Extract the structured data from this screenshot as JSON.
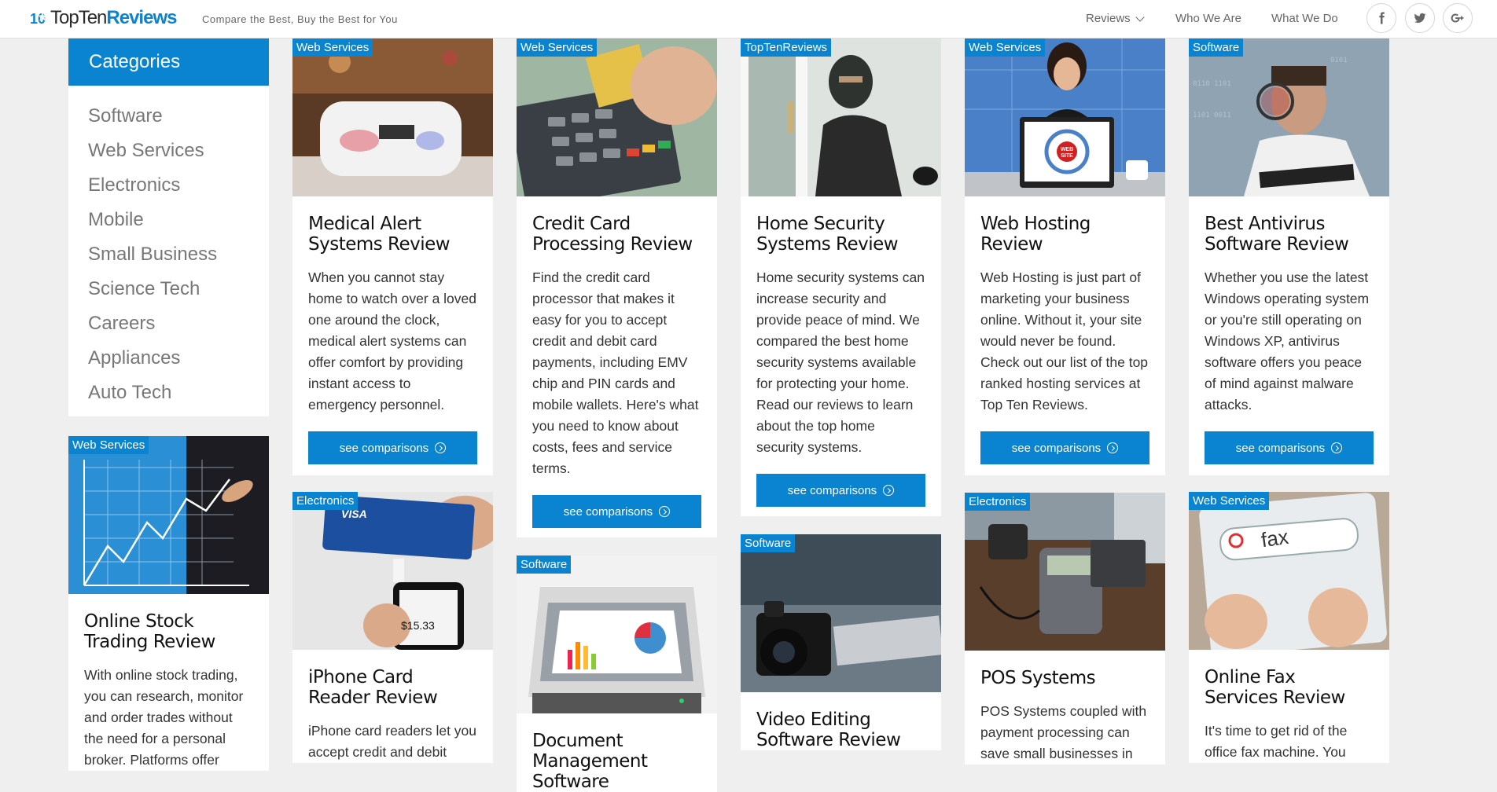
{
  "header": {
    "logo_prefix": "Top",
    "logo_mid": "Ten",
    "logo_suffix": "Reviews",
    "tagline": "Compare the Best, Buy the Best for You",
    "nav": {
      "reviews": "Reviews",
      "who": "Who We Are",
      "what": "What We Do"
    },
    "social_icons": [
      "facebook-icon",
      "twitter-icon",
      "google-plus-icon"
    ]
  },
  "sidebar": {
    "title": "Categories",
    "items": [
      "Software",
      "Web Services",
      "Electronics",
      "Mobile",
      "Small Business",
      "Science Tech",
      "Careers",
      "Appliances",
      "Auto Tech"
    ]
  },
  "button_label": "see comparisons",
  "cards": {
    "stock": {
      "tag": "Web Services",
      "title": "Online Stock Trading Review",
      "desc": "With online stock trading, you can research, monitor and order trades without the need for a personal broker. Platforms offer"
    },
    "medical": {
      "tag": "Web Services",
      "title": "Medical Alert Systems Review",
      "desc": "When you cannot stay home to watch over a loved one around the clock, medical alert systems can offer comfort by providing instant access to emergency personnel."
    },
    "iphone": {
      "tag": "Electronics",
      "title": "iPhone Card Reader Review",
      "desc": "iPhone card readers let you accept credit and debit"
    },
    "credit": {
      "tag": "Web Services",
      "title": "Credit Card Processing Review",
      "desc": "Find the credit card processor that makes it easy for you to accept credit and debit card payments, including EMV chip and PIN cards and mobile wallets. Here's what you need to know about costs, fees and service terms."
    },
    "document": {
      "tag": "Software",
      "title": "Document Management Software"
    },
    "security": {
      "tag": "TopTenReviews",
      "title": "Home Security Systems Review",
      "desc": "Home security systems can increase security and provide peace of mind. We compared the best home security systems available for protecting your home. Read our reviews to learn about the top home security systems."
    },
    "video": {
      "tag": "Software",
      "title": "Video Editing Software Review"
    },
    "hosting": {
      "tag": "Web Services",
      "title": "Web Hosting Review",
      "desc": "Web Hosting is just part of marketing your business online. Without it, your site would never be found. Check out our list of the top ranked hosting services at Top Ten Reviews."
    },
    "pos": {
      "tag": "Electronics",
      "title": "POS Systems",
      "desc": "POS Systems coupled with payment processing can save small businesses in"
    },
    "antivirus": {
      "tag": "Software",
      "title": "Best Antivirus Software Review",
      "desc": "Whether you use the latest Windows operating system or you're still operating on Windows XP, antivirus software offers you peace of mind against malware attacks."
    },
    "fax": {
      "tag": "Web Services",
      "title": "Online Fax Services Review",
      "desc": "It's time to get rid of the office fax machine. You"
    }
  },
  "image_text": {
    "iphone_price": "$15.33",
    "visa": "VISA",
    "website": "WEB SITE",
    "fax_search": "fax"
  },
  "colors": {
    "brand": "#0a84d0",
    "page_bg": "#efefef"
  }
}
